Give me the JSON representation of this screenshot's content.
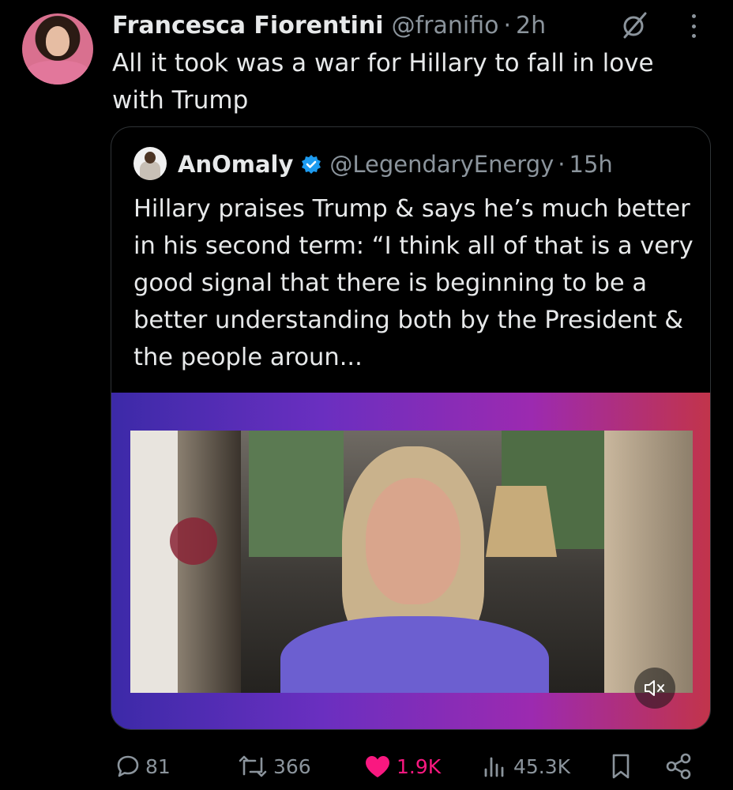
{
  "post": {
    "author_name": "Francesca Fiorentini",
    "author_handle": "@franifio",
    "separator": "·",
    "time": "2h",
    "text": "All it took was a war for Hillary to fall in love with Trump"
  },
  "quoted_post": {
    "author_name": "AnOmaly",
    "author_handle": "@LegendaryEnergy",
    "separator": "·",
    "time": "15h",
    "verified": true,
    "text": "Hillary praises Trump & says he’s much better in his second term: “I think all of that is a very good signal that there is beginning to be a better understanding both by the President & the people aroun..."
  },
  "media": {
    "type": "video",
    "muted": true,
    "icons": [
      "mute-icon"
    ]
  },
  "actions": {
    "replies": "81",
    "reposts": "366",
    "likes": "1.9K",
    "views": "45.3K",
    "icons": [
      "reply-icon",
      "repost-icon",
      "heart-icon",
      "views-icon",
      "bookmark-icon",
      "share-icon"
    ]
  },
  "colors": {
    "background": "#000000",
    "text": "#e7e9ea",
    "secondary": "#8b949c",
    "like": "#f91880",
    "verified": "#1d9bf0",
    "border": "#2f3336"
  }
}
